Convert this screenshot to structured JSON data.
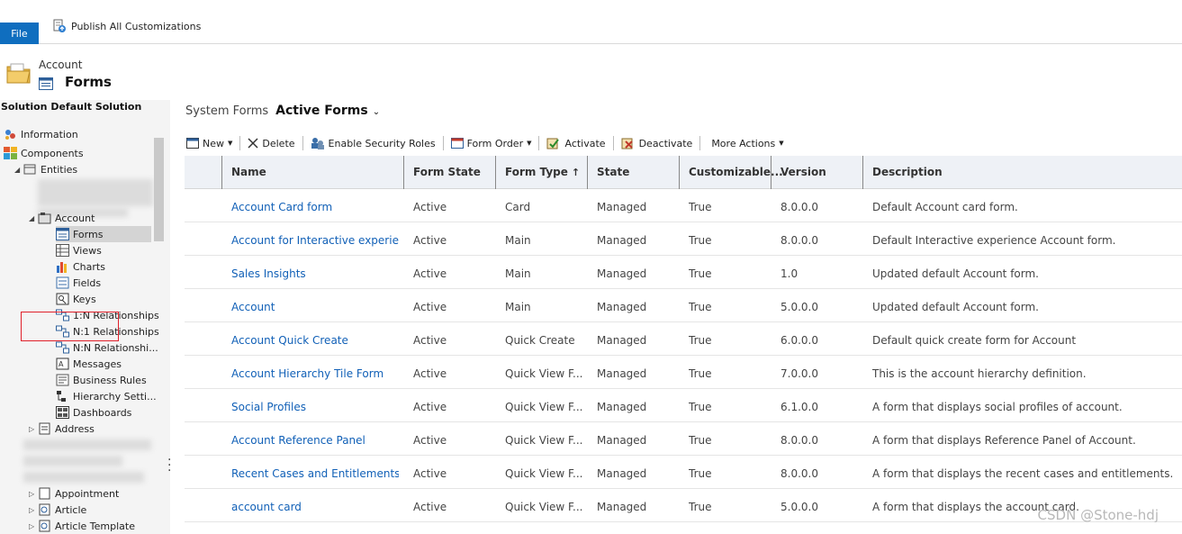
{
  "topbar": {
    "file_label": "File",
    "publish_label": "Publish All Customizations"
  },
  "breadcrumb": {
    "entity": "Account",
    "page_title": "Forms"
  },
  "sidebar": {
    "solution_title": "Solution Default Solution",
    "items": [
      {
        "label": "Information",
        "icon": "information-icon"
      },
      {
        "label": "Components",
        "icon": "components-icon"
      },
      {
        "label": "Entities",
        "icon": "entities-icon"
      },
      {
        "label": "Account",
        "icon": "account-entity-icon"
      },
      {
        "label": "Forms",
        "icon": "forms-icon"
      },
      {
        "label": "Views",
        "icon": "views-icon"
      },
      {
        "label": "Charts",
        "icon": "charts-icon"
      },
      {
        "label": "Fields",
        "icon": "fields-icon"
      },
      {
        "label": "Keys",
        "icon": "keys-icon"
      },
      {
        "label": "1:N Relationships",
        "icon": "relationship-icon"
      },
      {
        "label": "N:1 Relationships",
        "icon": "relationship-icon"
      },
      {
        "label": "N:N Relationshi...",
        "icon": "relationship-icon"
      },
      {
        "label": "Messages",
        "icon": "messages-icon"
      },
      {
        "label": "Business Rules",
        "icon": "business-rules-icon"
      },
      {
        "label": "Hierarchy Setti...",
        "icon": "hierarchy-icon"
      },
      {
        "label": "Dashboards",
        "icon": "dashboards-icon"
      },
      {
        "label": "Address",
        "icon": "entity-icon"
      },
      {
        "label": "Appointment",
        "icon": "entity-icon"
      },
      {
        "label": "Article",
        "icon": "entity-icon"
      },
      {
        "label": "Article Template",
        "icon": "entity-icon"
      }
    ]
  },
  "view": {
    "system_label": "System Forms",
    "active_label": "Active Forms"
  },
  "toolbar": {
    "new": "New",
    "delete": "Delete",
    "enable_security": "Enable Security Roles",
    "form_order": "Form Order",
    "activate": "Activate",
    "deactivate": "Deactivate",
    "more_actions": "More Actions"
  },
  "grid": {
    "columns": [
      "Name",
      "Form State",
      "Form Type",
      "State",
      "Customizable...",
      "Version",
      "Description"
    ],
    "rows": [
      [
        "Account Card form",
        "Active",
        "Card",
        "Managed",
        "True",
        "8.0.0.0",
        "Default Account card form."
      ],
      [
        "Account for Interactive experie...",
        "Active",
        "Main",
        "Managed",
        "True",
        "8.0.0.0",
        "Default Interactive experience Account form."
      ],
      [
        "Sales Insights",
        "Active",
        "Main",
        "Managed",
        "True",
        "1.0",
        "Updated default Account form."
      ],
      [
        "Account",
        "Active",
        "Main",
        "Managed",
        "True",
        "5.0.0.0",
        "Updated default Account form."
      ],
      [
        "Account Quick Create",
        "Active",
        "Quick Create",
        "Managed",
        "True",
        "6.0.0.0",
        "Default quick create form for Account"
      ],
      [
        "Account Hierarchy Tile Form",
        "Active",
        "Quick View F...",
        "Managed",
        "True",
        "7.0.0.0",
        "This is the account hierarchy definition."
      ],
      [
        "Social Profiles",
        "Active",
        "Quick View F...",
        "Managed",
        "True",
        "6.1.0.0",
        "A form that displays social profiles of account."
      ],
      [
        "Account Reference Panel",
        "Active",
        "Quick View F...",
        "Managed",
        "True",
        "8.0.0.0",
        "A form that displays Reference Panel of Account."
      ],
      [
        "Recent Cases and Entitlements",
        "Active",
        "Quick View F...",
        "Managed",
        "True",
        "8.0.0.0",
        "A form that displays the recent cases and entitlements."
      ],
      [
        "account card",
        "Active",
        "Quick View F...",
        "Managed",
        "True",
        "5.0.0.0",
        "A form that displays the account card."
      ]
    ]
  },
  "watermark": "CSDN @Stone-hdj",
  "colors": {
    "file_button": "#0f6ebf",
    "link": "#1160b7",
    "highlight_box": "#e0202a"
  }
}
